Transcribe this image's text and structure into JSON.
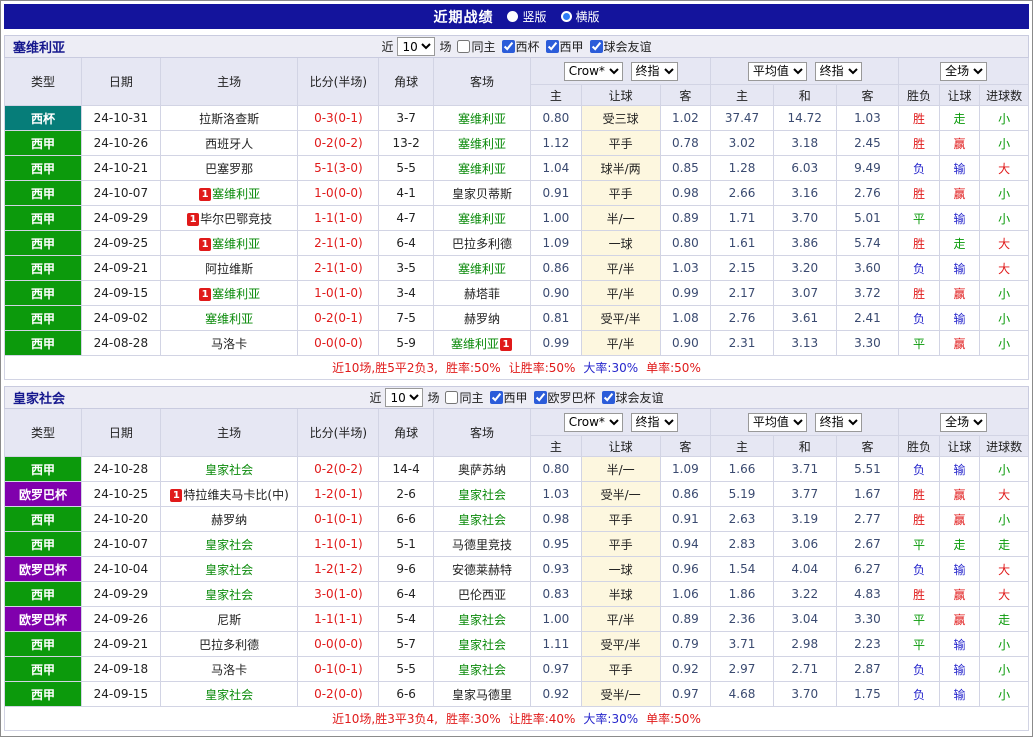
{
  "topbar": {
    "title": "近期战绩",
    "modes": [
      {
        "label": "竖版",
        "checked": false
      },
      {
        "label": "横版",
        "checked": true
      }
    ]
  },
  "sections": [
    {
      "team": "塞维利亚",
      "filter": {
        "prefix": "近",
        "count": "10",
        "suffix": "场",
        "same_home": {
          "label": "同主",
          "checked": false
        },
        "competitions": [
          {
            "label": "西杯",
            "checked": true
          },
          {
            "label": "西甲",
            "checked": true
          },
          {
            "label": "球会友谊",
            "checked": true
          }
        ]
      },
      "columns": {
        "type": "类型",
        "date": "日期",
        "home": "主场",
        "score": "比分(半场)",
        "corner": "角球",
        "away": "客场",
        "odds_group": {
          "source": "Crow*",
          "time": "终指",
          "sub": [
            "主",
            "让球",
            "客"
          ]
        },
        "avg_group": {
          "source": "平均值",
          "time": "终指",
          "sub": [
            "主",
            "和",
            "客"
          ]
        },
        "result_group": {
          "scope": "全场",
          "sub": [
            "胜负",
            "让球",
            "进球数"
          ]
        }
      },
      "rows": [
        {
          "type": {
            "label": "西杯",
            "key": "copa"
          },
          "date": "24-10-31",
          "home": {
            "text": "拉斯洛查斯"
          },
          "score": "0-3(0-1)",
          "corner": "3-7",
          "away": {
            "text": "塞维利亚",
            "self": true
          },
          "odds": [
            "0.80",
            "受三球",
            "1.02"
          ],
          "avg": [
            "37.47",
            "14.72",
            "1.03"
          ],
          "results": [
            {
              "t": "胜",
              "c": "red"
            },
            {
              "t": "走",
              "c": "green"
            },
            {
              "t": "小",
              "c": "green"
            }
          ]
        },
        {
          "type": {
            "label": "西甲",
            "key": "liga"
          },
          "date": "24-10-26",
          "home": {
            "text": "西班牙人"
          },
          "score": "0-2(0-2)",
          "corner": "13-2",
          "away": {
            "text": "塞维利亚",
            "self": true
          },
          "odds": [
            "1.12",
            "平手",
            "0.78"
          ],
          "avg": [
            "3.02",
            "3.18",
            "2.45"
          ],
          "results": [
            {
              "t": "胜",
              "c": "red"
            },
            {
              "t": "赢",
              "c": "red"
            },
            {
              "t": "小",
              "c": "green"
            }
          ]
        },
        {
          "type": {
            "label": "西甲",
            "key": "liga"
          },
          "date": "24-10-21",
          "home": {
            "text": "巴塞罗那"
          },
          "score": "5-1(3-0)",
          "corner": "5-5",
          "away": {
            "text": "塞维利亚",
            "self": true
          },
          "odds": [
            "1.04",
            "球半/两",
            "0.85"
          ],
          "avg": [
            "1.28",
            "6.03",
            "9.49"
          ],
          "results": [
            {
              "t": "负",
              "c": "blue"
            },
            {
              "t": "输",
              "c": "blue"
            },
            {
              "t": "大",
              "c": "red"
            }
          ]
        },
        {
          "type": {
            "label": "西甲",
            "key": "liga"
          },
          "date": "24-10-07",
          "home": {
            "text": "塞维利亚",
            "self": true,
            "badge": "1"
          },
          "score": "1-0(0-0)",
          "corner": "4-1",
          "away": {
            "text": "皇家贝蒂斯"
          },
          "odds": [
            "0.91",
            "平手",
            "0.98"
          ],
          "avg": [
            "2.66",
            "3.16",
            "2.76"
          ],
          "results": [
            {
              "t": "胜",
              "c": "red"
            },
            {
              "t": "赢",
              "c": "red"
            },
            {
              "t": "小",
              "c": "green"
            }
          ]
        },
        {
          "type": {
            "label": "西甲",
            "key": "liga"
          },
          "date": "24-09-29",
          "home": {
            "text": "毕尔巴鄂竞技",
            "badge": "1"
          },
          "score": "1-1(1-0)",
          "corner": "4-7",
          "away": {
            "text": "塞维利亚",
            "self": true
          },
          "odds": [
            "1.00",
            "半/一",
            "0.89"
          ],
          "avg": [
            "1.71",
            "3.70",
            "5.01"
          ],
          "results": [
            {
              "t": "平",
              "c": "green"
            },
            {
              "t": "输",
              "c": "blue"
            },
            {
              "t": "小",
              "c": "green"
            }
          ]
        },
        {
          "type": {
            "label": "西甲",
            "key": "liga"
          },
          "date": "24-09-25",
          "home": {
            "text": "塞维利亚",
            "self": true,
            "badge": "1"
          },
          "score": "2-1(1-0)",
          "corner": "6-4",
          "away": {
            "text": "巴拉多利德"
          },
          "odds": [
            "1.09",
            "一球",
            "0.80"
          ],
          "avg": [
            "1.61",
            "3.86",
            "5.74"
          ],
          "results": [
            {
              "t": "胜",
              "c": "red"
            },
            {
              "t": "走",
              "c": "green"
            },
            {
              "t": "大",
              "c": "red"
            }
          ]
        },
        {
          "type": {
            "label": "西甲",
            "key": "liga"
          },
          "date": "24-09-21",
          "home": {
            "text": "阿拉维斯"
          },
          "score": "2-1(1-0)",
          "corner": "3-5",
          "away": {
            "text": "塞维利亚",
            "self": true
          },
          "odds": [
            "0.86",
            "平/半",
            "1.03"
          ],
          "avg": [
            "2.15",
            "3.20",
            "3.60"
          ],
          "results": [
            {
              "t": "负",
              "c": "blue"
            },
            {
              "t": "输",
              "c": "blue"
            },
            {
              "t": "大",
              "c": "red"
            }
          ]
        },
        {
          "type": {
            "label": "西甲",
            "key": "liga"
          },
          "date": "24-09-15",
          "home": {
            "text": "塞维利亚",
            "self": true,
            "badge": "1"
          },
          "score": "1-0(1-0)",
          "corner": "3-4",
          "away": {
            "text": "赫塔菲"
          },
          "odds": [
            "0.90",
            "平/半",
            "0.99"
          ],
          "avg": [
            "2.17",
            "3.07",
            "3.72"
          ],
          "results": [
            {
              "t": "胜",
              "c": "red"
            },
            {
              "t": "赢",
              "c": "red"
            },
            {
              "t": "小",
              "c": "green"
            }
          ]
        },
        {
          "type": {
            "label": "西甲",
            "key": "liga"
          },
          "date": "24-09-02",
          "home": {
            "text": "塞维利亚",
            "self": true
          },
          "score": "0-2(0-1)",
          "corner": "7-5",
          "away": {
            "text": "赫罗纳"
          },
          "odds": [
            "0.81",
            "受平/半",
            "1.08"
          ],
          "avg": [
            "2.76",
            "3.61",
            "2.41"
          ],
          "results": [
            {
              "t": "负",
              "c": "blue"
            },
            {
              "t": "输",
              "c": "blue"
            },
            {
              "t": "小",
              "c": "green"
            }
          ]
        },
        {
          "type": {
            "label": "西甲",
            "key": "liga"
          },
          "date": "24-08-28",
          "home": {
            "text": "马洛卡"
          },
          "score": "0-0(0-0)",
          "corner": "5-9",
          "away": {
            "text": "塞维利亚",
            "self": true,
            "badge": "1",
            "badge_after": true
          },
          "odds": [
            "0.99",
            "平/半",
            "0.90"
          ],
          "avg": [
            "2.31",
            "3.13",
            "3.30"
          ],
          "results": [
            {
              "t": "平",
              "c": "green"
            },
            {
              "t": "赢",
              "c": "red"
            },
            {
              "t": "小",
              "c": "green"
            }
          ]
        }
      ],
      "summary": [
        {
          "t": "近10场,胜5平2负3,",
          "c": "red"
        },
        {
          "t": "胜率:50%",
          "c": "red"
        },
        {
          "t": "让胜率:50%",
          "c": "red"
        },
        {
          "t": "大率:30%",
          "c": "blue"
        },
        {
          "t": "单率:50%",
          "c": "red"
        }
      ]
    },
    {
      "team": "皇家社会",
      "filter": {
        "prefix": "近",
        "count": "10",
        "suffix": "场",
        "same_home": {
          "label": "同主",
          "checked": false
        },
        "competitions": [
          {
            "label": "西甲",
            "checked": true
          },
          {
            "label": "欧罗巴杯",
            "checked": true
          },
          {
            "label": "球会友谊",
            "checked": true
          }
        ]
      },
      "columns": {
        "type": "类型",
        "date": "日期",
        "home": "主场",
        "score": "比分(半场)",
        "corner": "角球",
        "away": "客场",
        "odds_group": {
          "source": "Crow*",
          "time": "终指",
          "sub": [
            "主",
            "让球",
            "客"
          ]
        },
        "avg_group": {
          "source": "平均值",
          "time": "终指",
          "sub": [
            "主",
            "和",
            "客"
          ]
        },
        "result_group": {
          "scope": "全场",
          "sub": [
            "胜负",
            "让球",
            "进球数"
          ]
        }
      },
      "rows": [
        {
          "type": {
            "label": "西甲",
            "key": "liga"
          },
          "date": "24-10-28",
          "home": {
            "text": "皇家社会",
            "self": true
          },
          "score": "0-2(0-2)",
          "corner": "14-4",
          "away": {
            "text": "奥萨苏纳"
          },
          "odds": [
            "0.80",
            "半/一",
            "1.09"
          ],
          "avg": [
            "1.66",
            "3.71",
            "5.51"
          ],
          "results": [
            {
              "t": "负",
              "c": "blue"
            },
            {
              "t": "输",
              "c": "blue"
            },
            {
              "t": "小",
              "c": "green"
            }
          ]
        },
        {
          "type": {
            "label": "欧罗巴杯",
            "key": "europa"
          },
          "date": "24-10-25",
          "home": {
            "text": "特拉维夫马卡比(中)",
            "badge": "1"
          },
          "score": "1-2(0-1)",
          "corner": "2-6",
          "away": {
            "text": "皇家社会",
            "self": true
          },
          "odds": [
            "1.03",
            "受半/一",
            "0.86"
          ],
          "avg": [
            "5.19",
            "3.77",
            "1.67"
          ],
          "results": [
            {
              "t": "胜",
              "c": "red"
            },
            {
              "t": "赢",
              "c": "red"
            },
            {
              "t": "大",
              "c": "red"
            }
          ]
        },
        {
          "type": {
            "label": "西甲",
            "key": "liga"
          },
          "date": "24-10-20",
          "home": {
            "text": "赫罗纳"
          },
          "score": "0-1(0-1)",
          "corner": "6-6",
          "away": {
            "text": "皇家社会",
            "self": true
          },
          "odds": [
            "0.98",
            "平手",
            "0.91"
          ],
          "avg": [
            "2.63",
            "3.19",
            "2.77"
          ],
          "results": [
            {
              "t": "胜",
              "c": "red"
            },
            {
              "t": "赢",
              "c": "red"
            },
            {
              "t": "小",
              "c": "green"
            }
          ]
        },
        {
          "type": {
            "label": "西甲",
            "key": "liga"
          },
          "date": "24-10-07",
          "home": {
            "text": "皇家社会",
            "self": true
          },
          "score": "1-1(0-1)",
          "corner": "5-1",
          "away": {
            "text": "马德里竞技"
          },
          "odds": [
            "0.95",
            "平手",
            "0.94"
          ],
          "avg": [
            "2.83",
            "3.06",
            "2.67"
          ],
          "results": [
            {
              "t": "平",
              "c": "green"
            },
            {
              "t": "走",
              "c": "green"
            },
            {
              "t": "走",
              "c": "green"
            }
          ]
        },
        {
          "type": {
            "label": "欧罗巴杯",
            "key": "europa"
          },
          "date": "24-10-04",
          "home": {
            "text": "皇家社会",
            "self": true
          },
          "score": "1-2(1-2)",
          "corner": "9-6",
          "away": {
            "text": "安德莱赫特"
          },
          "odds": [
            "0.93",
            "一球",
            "0.96"
          ],
          "avg": [
            "1.54",
            "4.04",
            "6.27"
          ],
          "results": [
            {
              "t": "负",
              "c": "blue"
            },
            {
              "t": "输",
              "c": "blue"
            },
            {
              "t": "大",
              "c": "red"
            }
          ]
        },
        {
          "type": {
            "label": "西甲",
            "key": "liga"
          },
          "date": "24-09-29",
          "home": {
            "text": "皇家社会",
            "self": true
          },
          "score": "3-0(1-0)",
          "corner": "6-4",
          "away": {
            "text": "巴伦西亚"
          },
          "odds": [
            "0.83",
            "半球",
            "1.06"
          ],
          "avg": [
            "1.86",
            "3.22",
            "4.83"
          ],
          "results": [
            {
              "t": "胜",
              "c": "red"
            },
            {
              "t": "赢",
              "c": "red"
            },
            {
              "t": "大",
              "c": "red"
            }
          ]
        },
        {
          "type": {
            "label": "欧罗巴杯",
            "key": "europa"
          },
          "date": "24-09-26",
          "home": {
            "text": "尼斯"
          },
          "score": "1-1(1-1)",
          "corner": "5-4",
          "away": {
            "text": "皇家社会",
            "self": true
          },
          "odds": [
            "1.00",
            "平/半",
            "0.89"
          ],
          "avg": [
            "2.36",
            "3.04",
            "3.30"
          ],
          "results": [
            {
              "t": "平",
              "c": "green"
            },
            {
              "t": "赢",
              "c": "red"
            },
            {
              "t": "走",
              "c": "green"
            }
          ]
        },
        {
          "type": {
            "label": "西甲",
            "key": "liga"
          },
          "date": "24-09-21",
          "home": {
            "text": "巴拉多利德"
          },
          "score": "0-0(0-0)",
          "corner": "5-7",
          "away": {
            "text": "皇家社会",
            "self": true
          },
          "odds": [
            "1.11",
            "受平/半",
            "0.79"
          ],
          "avg": [
            "3.71",
            "2.98",
            "2.23"
          ],
          "results": [
            {
              "t": "平",
              "c": "green"
            },
            {
              "t": "输",
              "c": "blue"
            },
            {
              "t": "小",
              "c": "green"
            }
          ]
        },
        {
          "type": {
            "label": "西甲",
            "key": "liga"
          },
          "date": "24-09-18",
          "home": {
            "text": "马洛卡"
          },
          "score": "0-1(0-1)",
          "corner": "5-5",
          "away": {
            "text": "皇家社会",
            "self": true
          },
          "odds": [
            "0.97",
            "平手",
            "0.92"
          ],
          "avg": [
            "2.97",
            "2.71",
            "2.87"
          ],
          "results": [
            {
              "t": "负",
              "c": "blue"
            },
            {
              "t": "输",
              "c": "blue"
            },
            {
              "t": "小",
              "c": "green"
            }
          ]
        },
        {
          "type": {
            "label": "西甲",
            "key": "liga"
          },
          "date": "24-09-15",
          "home": {
            "text": "皇家社会",
            "self": true
          },
          "score": "0-2(0-0)",
          "corner": "6-6",
          "away": {
            "text": "皇家马德里"
          },
          "odds": [
            "0.92",
            "受半/一",
            "0.97"
          ],
          "avg": [
            "4.68",
            "3.70",
            "1.75"
          ],
          "results": [
            {
              "t": "负",
              "c": "blue"
            },
            {
              "t": "输",
              "c": "blue"
            },
            {
              "t": "小",
              "c": "green"
            }
          ]
        }
      ],
      "summary": [
        {
          "t": "近10场,胜3平3负4,",
          "c": "red"
        },
        {
          "t": "胜率:30%",
          "c": "red"
        },
        {
          "t": "让胜率:40%",
          "c": "red"
        },
        {
          "t": "大率:30%",
          "c": "blue"
        },
        {
          "t": "单率:50%",
          "c": "red"
        }
      ]
    }
  ]
}
